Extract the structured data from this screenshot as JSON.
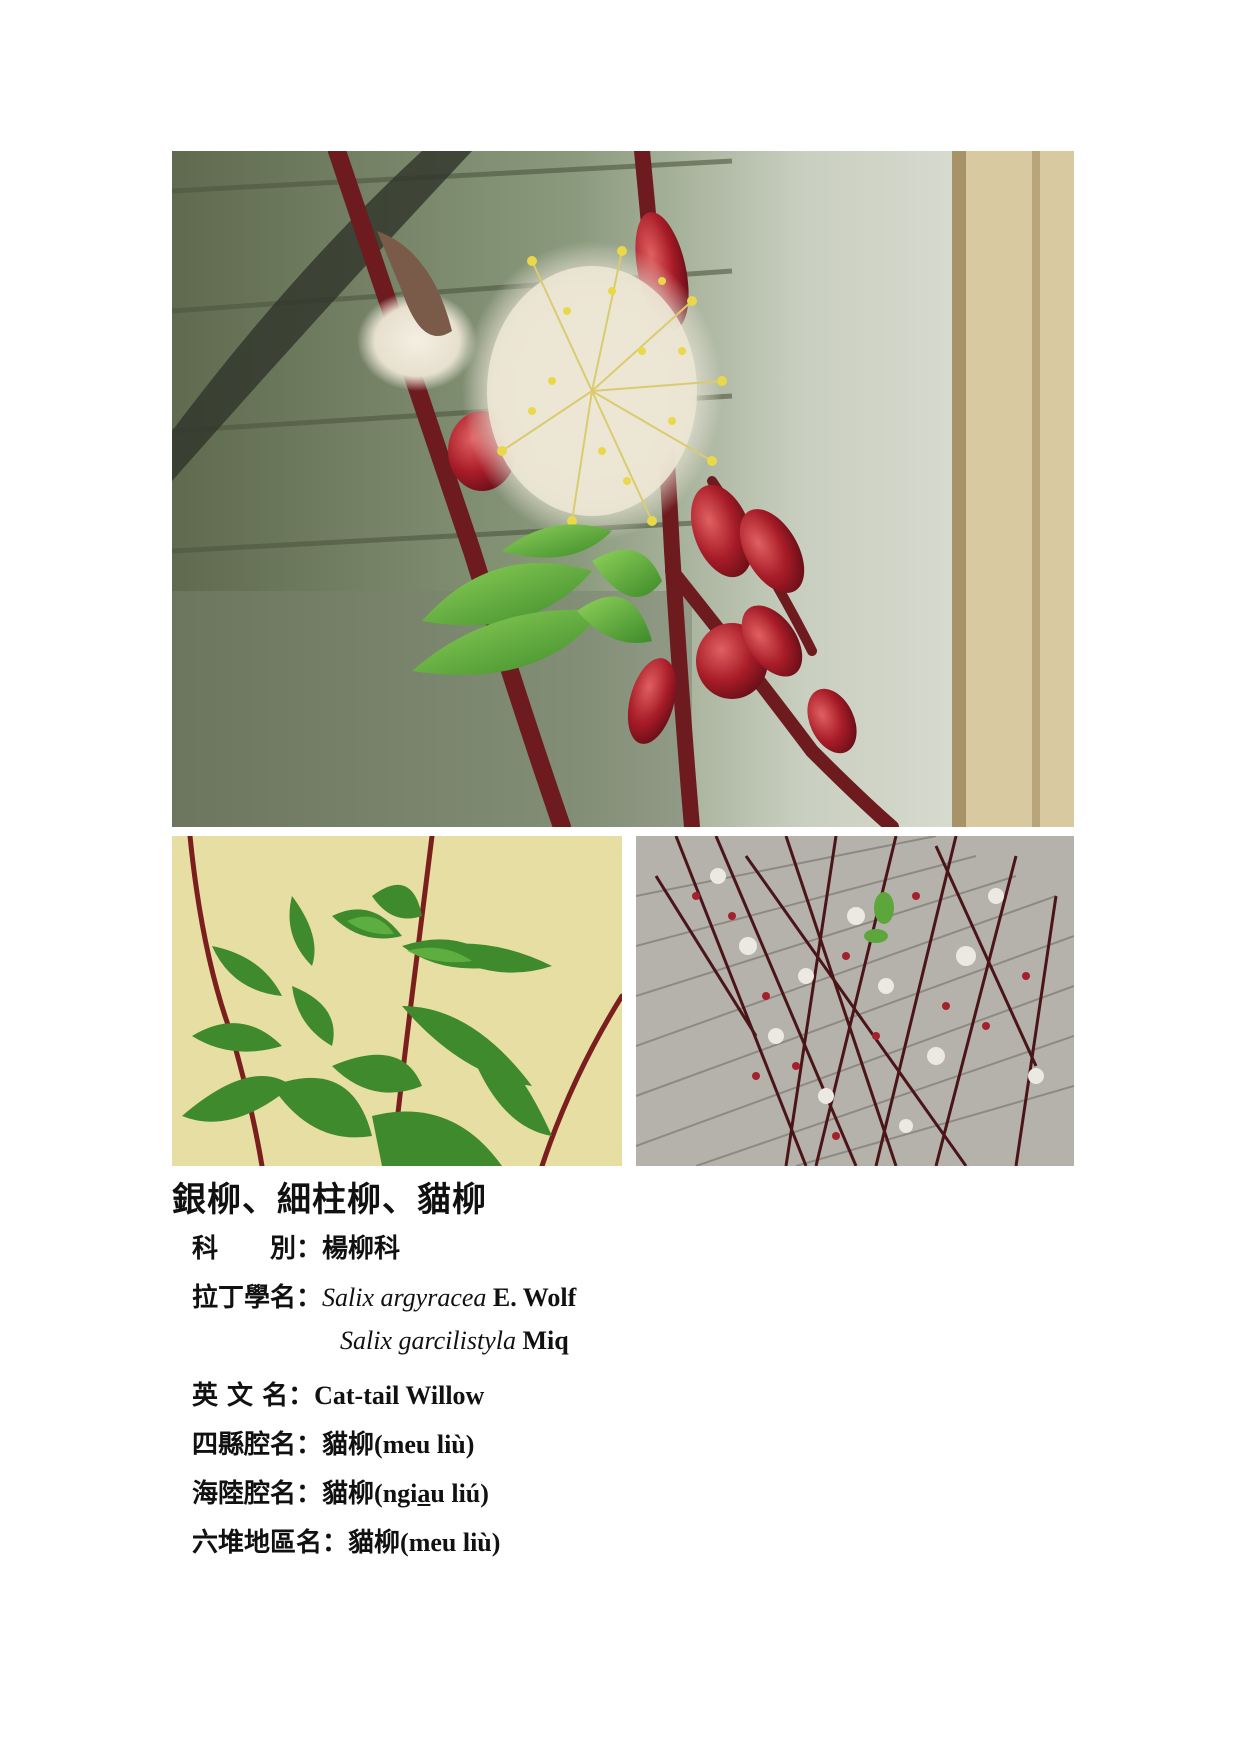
{
  "photos": {
    "main": "pussy willow catkin with yellow stamens and red buds",
    "leaves": "green willow leaves against a yellow wall",
    "twigs": "willow twigs with catkins over a wooden deck"
  },
  "title": "銀柳、細柱柳、貓柳",
  "info": {
    "family_label": "科　　別",
    "family_value": "楊柳科",
    "latin_label": "拉丁學名",
    "latin_1_genus_species": "Salix argyracea",
    "latin_1_author": "E. Wolf",
    "latin_2_genus_species": "Salix garcilistyla",
    "latin_2_author": "Miq",
    "english_label": "英 文 名",
    "english_value": "Cat-tail Willow",
    "sixian_label": "四縣腔名",
    "sixian_han": "貓柳",
    "sixian_roman": "(meu liù)",
    "hailu_label": "海陸腔名",
    "hailu_han": "貓柳",
    "hailu_roman_pre": "(ngi",
    "hailu_roman_u": "a",
    "hailu_roman_post": "u liú)",
    "liudui_label": "六堆地區名",
    "liudui_han": "貓柳",
    "liudui_roman": "(meu liù)",
    "colon": "："
  },
  "colors": {
    "stem": "#7a1e1e",
    "bud": "#b0202a",
    "leaf": "#5fae3a",
    "catkin": "#efe9dc",
    "stamen": "#e6d84a",
    "wall": "#e9e2a8",
    "deck": "#b9b6b0"
  }
}
